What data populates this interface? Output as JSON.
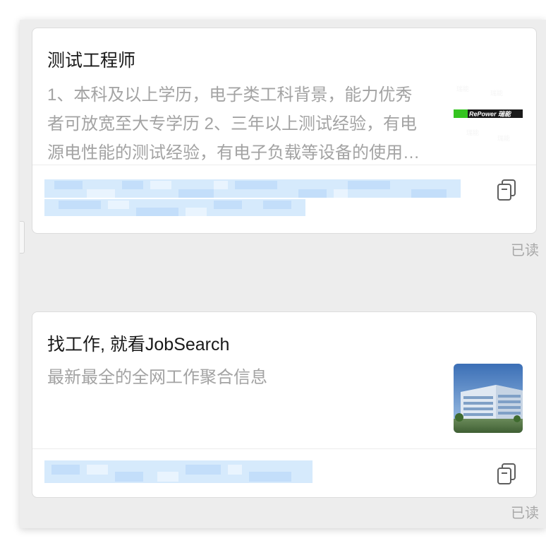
{
  "messages": [
    {
      "title": "测试工程师",
      "description": "1、本科及以上学历，电子类工科背景，能力优秀者可放宽至大专学历 2、三年以上测试经验，有电源电性能的测试经验，有电子负载等设备的使用经验",
      "thumbnail_logo_text": "RePower 瑞能",
      "thumbnail_icon": "company-logo",
      "copy_icon": "copy-icon",
      "status": "已读"
    },
    {
      "title": "找工作, 就看JobSearch",
      "description": "最新最全的全网工作聚合信息",
      "thumbnail_icon": "building-photo",
      "copy_icon": "copy-icon",
      "status": "已读"
    }
  ],
  "colors": {
    "background": "#ededed",
    "card": "#ffffff",
    "title": "#191919",
    "description": "#a3a3a3",
    "blurred_link": "#cfe6fb",
    "brand_green": "#34c420"
  }
}
